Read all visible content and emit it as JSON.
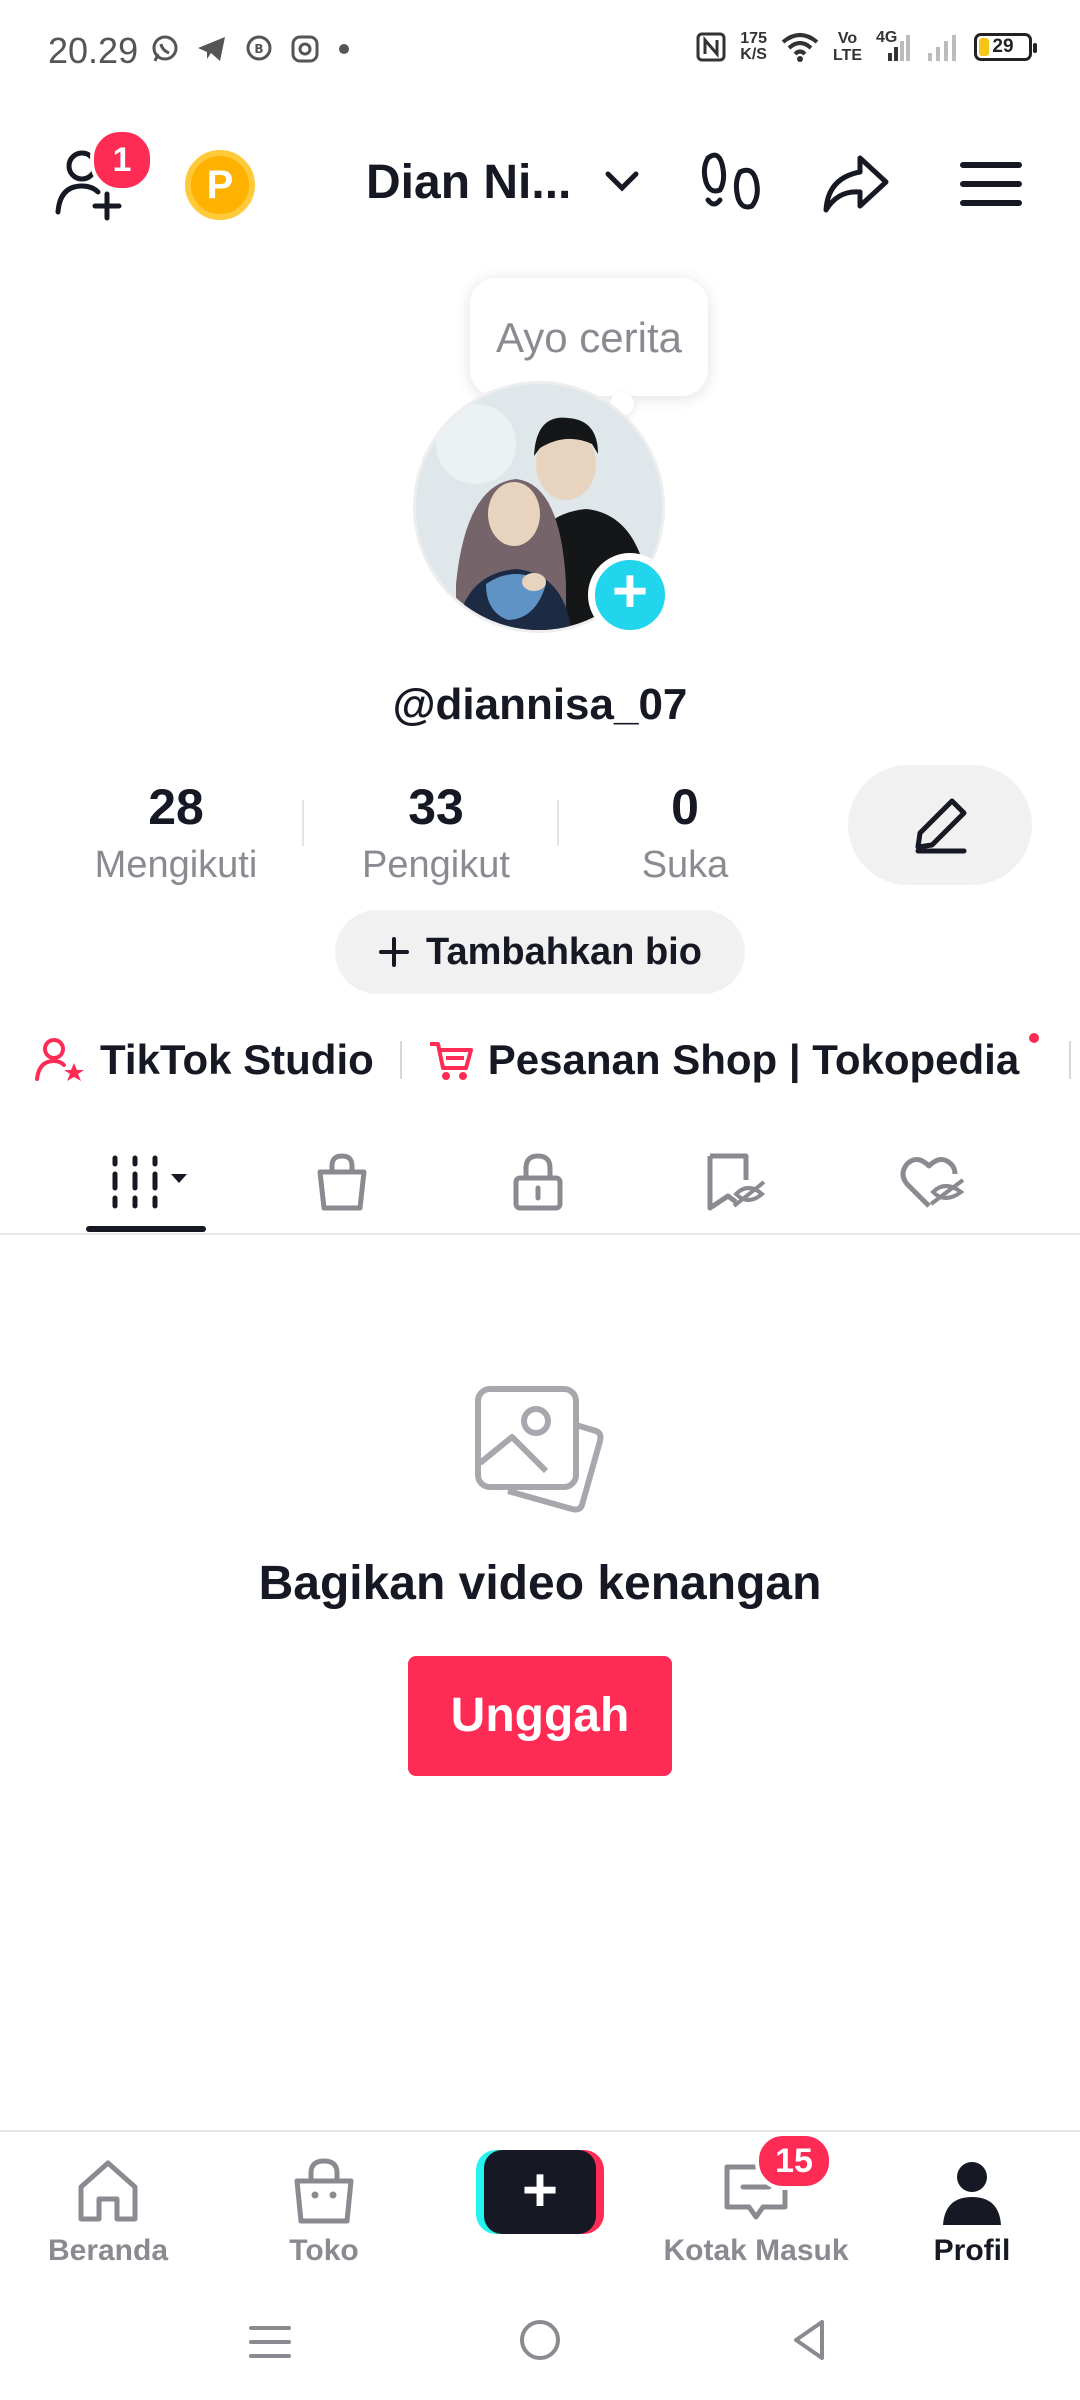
{
  "status_bar": {
    "time": "20.29",
    "net_speed_value": "175",
    "net_speed_unit": "K/S",
    "volte_top": "Vo",
    "volte_bottom": "LTE",
    "network": "4G",
    "battery": "29",
    "left_icons": [
      "whatsapp-icon",
      "telegram-icon",
      "whatsapp-business-icon",
      "instagram-icon",
      "dot-icon"
    ]
  },
  "header": {
    "add_friends_badge": "1",
    "coin_letter": "P",
    "account_name": "Dian Ni..."
  },
  "profile": {
    "tooltip": "Ayo cerita",
    "handle": "@diannisa_07",
    "stats": [
      {
        "value": "28",
        "label": "Mengikuti"
      },
      {
        "value": "33",
        "label": "Pengikut"
      },
      {
        "value": "0",
        "label": "Suka"
      }
    ],
    "bio_button": "Tambahkan bio",
    "links": [
      {
        "label": "TikTok Studio"
      },
      {
        "label": "Pesanan Shop | Tokopedia"
      }
    ]
  },
  "empty_state": {
    "title": "Bagikan video kenangan",
    "button": "Unggah"
  },
  "bottom_nav": {
    "items": [
      {
        "label": "Beranda"
      },
      {
        "label": "Toko"
      },
      {
        "label": "Kotak Masuk"
      },
      {
        "label": "Profil"
      }
    ],
    "inbox_badge": "15"
  },
  "colors": {
    "accent": "#fe2c55",
    "teal": "#20d5ec",
    "text": "#161823",
    "muted": "#8a8b91"
  }
}
